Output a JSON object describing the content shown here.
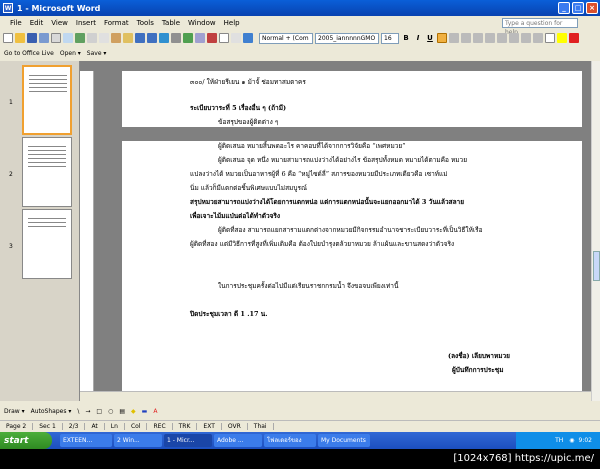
{
  "window": {
    "title": "1 - Microsoft Word"
  },
  "menu": [
    "File",
    "Edit",
    "View",
    "Insert",
    "Format",
    "Tools",
    "Table",
    "Window",
    "Help"
  ],
  "help_placeholder": "Type a question for help",
  "format": {
    "style": "Normal + (Com",
    "font": "2005_iannnnnGMO",
    "size": "16",
    "bold": "B",
    "italic": "I",
    "underline": "U"
  },
  "toolbar2": {
    "office_live": "Go to Office Live",
    "open": "Open ▾",
    "save": "Save ▾"
  },
  "thumbs": [
    "1",
    "2",
    "3"
  ],
  "doc": {
    "l1": "๓๐๐/ ให้ฝ่ายรีเยน ๑ ม้าจั้ ช่อมทาสมตาคร",
    "l2": "ระเบียบวาระที่ 5 เรื่องอื่น ๆ (ถ้ามี)",
    "l3": "ข้อสรุปของผู้ติดต่าง ๆ",
    "l4": "ผู้ติดเสนอ หมายสิ้นพดอะไร คาคอบที่ได้จากการวิจัยคือ “เพศหมวย”",
    "l5": "ผู้ติดเสนอ จุด หนึ่ง หมายสามารถแบ่งว่างได้อย่างไร ข้อสรุปทั้งหมด หมายได้ตามคือ หมวย",
    "l6": "แปลงว่างได้ หมวยเป็นอาหารผู้ที่ 6 คือ “หมู่ไซด์ลี่” สภารของหมวยมีประเภทเดียวคือ เซาท์แม่",
    "l7": "นิ่ม แล้วก็มีแตกต่อชิ้นพิเศษแบบไม่สมบูรณ์",
    "l8": "สรุปหมวยสามารถแบ่งว่างได้โดยการแตกหน่อ แต่การแตกหน่อนั้นจะแยกออกมาได้ 3 วันแล้วสลาย",
    "l9": "เพื่อเจาะไม้มแป่นต่อได้ทำตัวจริง",
    "l10": "ผู้ติดที่สอง สามารถแยกสารามแตกต่างจากหมวยมีกิจกรรมอำนาจชาระเบียบวาระที่เป็นวิธีให้เรือ",
    "l11": "ผู้ติดที่สอง แต่มีวิธีการที่สูงที่เพิ่มเติมคือ ต้องใบ่ยบำรุงตล้วยาหมวย ล้าแผ้นและขานสดงว่าตัวจริง",
    "l12": "ในการประชุมครั้งต่อไปมีแต่เรียนราชกกรมน้ำ จึงขอจบเพียงเท่านี้",
    "l13": "ปิดประชุมเวลา ตี 1 .17 น.",
    "l14": "(ลงชื่อ) เลียบพาหมวย",
    "l15": "ผู้บันทึกการประชุม"
  },
  "status": {
    "page": "Page 2",
    "sec": "Sec 1",
    "pos": "2/3",
    "at": "At",
    "ln": "Ln",
    "col": "Col",
    "rec": "REC",
    "trk": "TRK",
    "ext": "EXT",
    "ovr": "OVR",
    "lang": "Thai"
  },
  "draw": {
    "draw": "Draw ▾",
    "autoshapes": "AutoShapes ▾"
  },
  "taskbar": {
    "start": "start",
    "tasks": [
      "EXTEEN...",
      "2 Win...",
      "1 - Micr...",
      "Adobe ...",
      "โฟลเดอร์ของ",
      "My Documents"
    ],
    "lang": "TH",
    "time": "9:02"
  },
  "footer": "[1024x768] https://upic.me/"
}
